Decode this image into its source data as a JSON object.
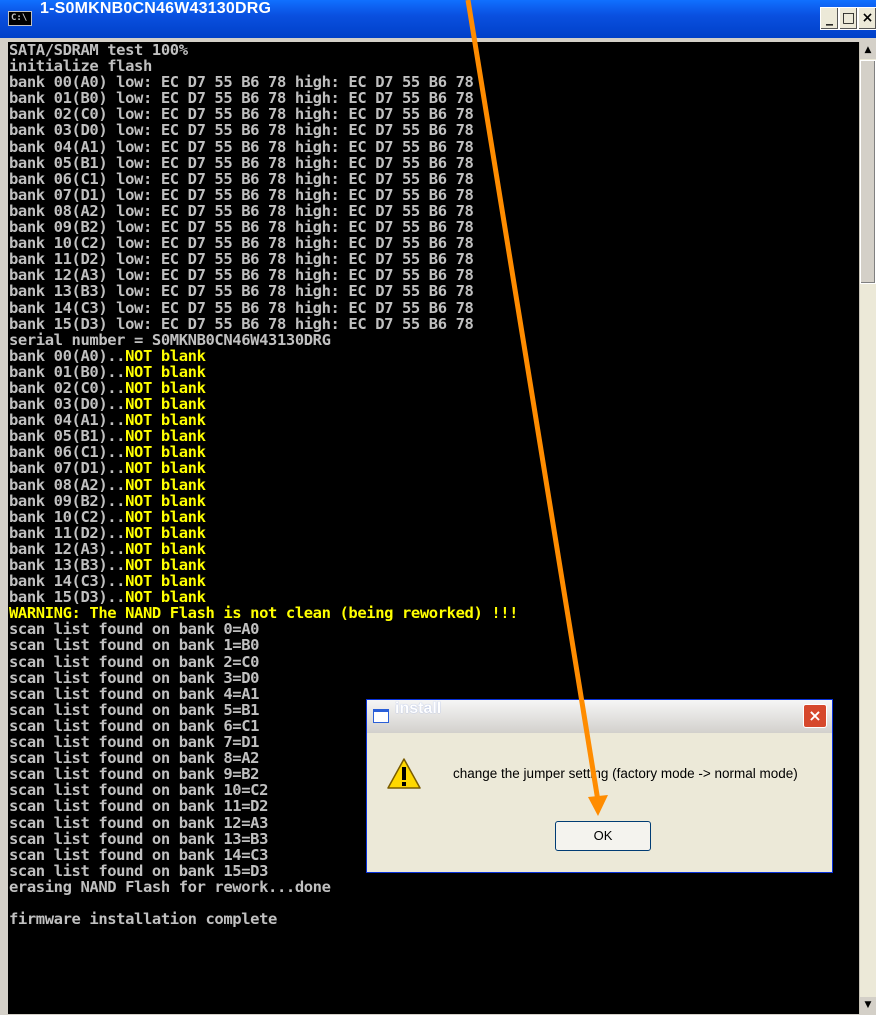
{
  "window": {
    "title": "1-S0MKNB0CN46W43130DRG",
    "minimize_label": "_",
    "maximize_label": "□",
    "close_label": "×"
  },
  "console": {
    "lines": [
      {
        "t": "SATA/SDRAM test 100%"
      },
      {
        "t": "initialize flash"
      },
      {
        "t": "bank 00(A0) low: EC D7 55 B6 78 high: EC D7 55 B6 78"
      },
      {
        "t": "bank 01(B0) low: EC D7 55 B6 78 high: EC D7 55 B6 78"
      },
      {
        "t": "bank 02(C0) low: EC D7 55 B6 78 high: EC D7 55 B6 78"
      },
      {
        "t": "bank 03(D0) low: EC D7 55 B6 78 high: EC D7 55 B6 78"
      },
      {
        "t": "bank 04(A1) low: EC D7 55 B6 78 high: EC D7 55 B6 78"
      },
      {
        "t": "bank 05(B1) low: EC D7 55 B6 78 high: EC D7 55 B6 78"
      },
      {
        "t": "bank 06(C1) low: EC D7 55 B6 78 high: EC D7 55 B6 78"
      },
      {
        "t": "bank 07(D1) low: EC D7 55 B6 78 high: EC D7 55 B6 78"
      },
      {
        "t": "bank 08(A2) low: EC D7 55 B6 78 high: EC D7 55 B6 78"
      },
      {
        "t": "bank 09(B2) low: EC D7 55 B6 78 high: EC D7 55 B6 78"
      },
      {
        "t": "bank 10(C2) low: EC D7 55 B6 78 high: EC D7 55 B6 78"
      },
      {
        "t": "bank 11(D2) low: EC D7 55 B6 78 high: EC D7 55 B6 78"
      },
      {
        "t": "bank 12(A3) low: EC D7 55 B6 78 high: EC D7 55 B6 78"
      },
      {
        "t": "bank 13(B3) low: EC D7 55 B6 78 high: EC D7 55 B6 78"
      },
      {
        "t": "bank 14(C3) low: EC D7 55 B6 78 high: EC D7 55 B6 78"
      },
      {
        "t": "bank 15(D3) low: EC D7 55 B6 78 high: EC D7 55 B6 78"
      },
      {
        "t": "serial number = S0MKNB0CN46W43130DRG"
      },
      {
        "t": "bank 00(A0)..",
        "y": "NOT blank"
      },
      {
        "t": "bank 01(B0)..",
        "y": "NOT blank"
      },
      {
        "t": "bank 02(C0)..",
        "y": "NOT blank"
      },
      {
        "t": "bank 03(D0)..",
        "y": "NOT blank"
      },
      {
        "t": "bank 04(A1)..",
        "y": "NOT blank"
      },
      {
        "t": "bank 05(B1)..",
        "y": "NOT blank"
      },
      {
        "t": "bank 06(C1)..",
        "y": "NOT blank"
      },
      {
        "t": "bank 07(D1)..",
        "y": "NOT blank"
      },
      {
        "t": "bank 08(A2)..",
        "y": "NOT blank"
      },
      {
        "t": "bank 09(B2)..",
        "y": "NOT blank"
      },
      {
        "t": "bank 10(C2)..",
        "y": "NOT blank"
      },
      {
        "t": "bank 11(D2)..",
        "y": "NOT blank"
      },
      {
        "t": "bank 12(A3)..",
        "y": "NOT blank"
      },
      {
        "t": "bank 13(B3)..",
        "y": "NOT blank"
      },
      {
        "t": "bank 14(C3)..",
        "y": "NOT blank"
      },
      {
        "t": "bank 15(D3)..",
        "y": "NOT blank"
      },
      {
        "t": "",
        "y": "WARNING: The NAND Flash is not clean (being reworked) !!!"
      },
      {
        "t": "scan list found on bank 0=A0"
      },
      {
        "t": "scan list found on bank 1=B0"
      },
      {
        "t": "scan list found on bank 2=C0"
      },
      {
        "t": "scan list found on bank 3=D0"
      },
      {
        "t": "scan list found on bank 4=A1"
      },
      {
        "t": "scan list found on bank 5=B1"
      },
      {
        "t": "scan list found on bank 6=C1"
      },
      {
        "t": "scan list found on bank 7=D1"
      },
      {
        "t": "scan list found on bank 8=A2"
      },
      {
        "t": "scan list found on bank 9=B2"
      },
      {
        "t": "scan list found on bank 10=C2"
      },
      {
        "t": "scan list found on bank 11=D2"
      },
      {
        "t": "scan list found on bank 12=A3"
      },
      {
        "t": "scan list found on bank 13=B3"
      },
      {
        "t": "scan list found on bank 14=C3"
      },
      {
        "t": "scan list found on bank 15=D3"
      },
      {
        "t": "erasing NAND Flash for rework...done"
      },
      {
        "t": ""
      },
      {
        "t": "firmware installation complete"
      }
    ]
  },
  "dialog": {
    "title": "install",
    "message": "change the jumper setting (factory mode -> normal mode)",
    "ok_label": "OK",
    "close_label": "×",
    "icon": "warning-icon"
  },
  "colors": {
    "console_text": "#c0c0c0",
    "console_highlight": "#ffff00",
    "console_background": "#000000",
    "title_bar": "#0a50e0",
    "annotation_arrow": "#ff8c00"
  }
}
